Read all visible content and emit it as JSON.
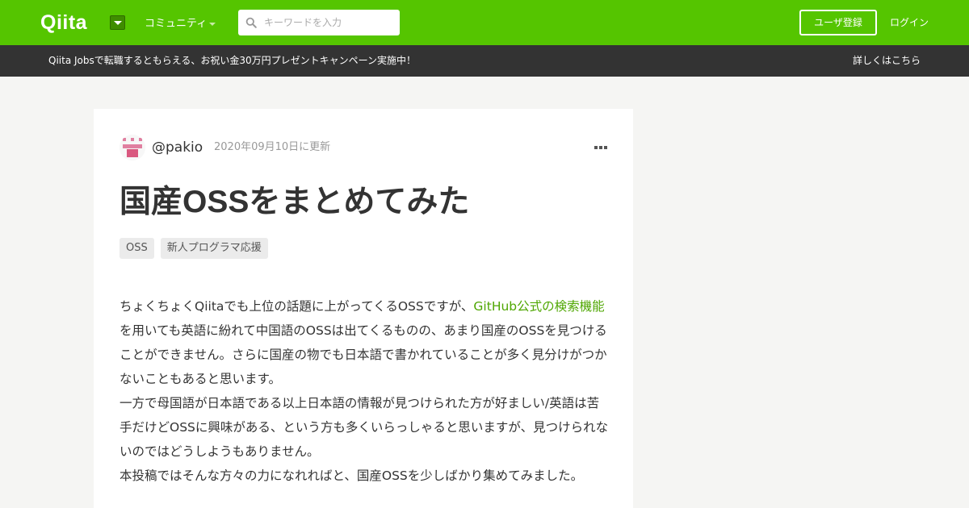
{
  "header": {
    "logo": "Qiita",
    "community_label": "コミュニティ",
    "search_placeholder": "キーワードを入力",
    "signup_label": "ユーザ登録",
    "login_label": "ログイン",
    "brand_color": "#55c500"
  },
  "banner": {
    "text": "Qiita Jobsで転職するともらえる、お祝い金30万円プレゼントキャンペーン実施中！",
    "link": "詳しくはこちら"
  },
  "article": {
    "author": "@pakio",
    "updated": "2020年09月10日に更新",
    "title": "国産OSSをまとめてみた",
    "tags": [
      "OSS",
      "新人プログラマ応援"
    ],
    "para1_before": "ちょくちょくQiitaでも上位の話題に上がってくるOSSですが、",
    "para1_link": "GitHub公式の検索機能",
    "para1_after": "を用いても英語に紛れて中国語のOSSは出てくるものの、あまり国産のOSSを見つけることができません。さらに国産の物でも日本語で書かれていることが多く見分けがつかないこともあると思います。",
    "para2": "一方で母国語が日本語である以上日本語の情報が見つけられた方が好ましい/英語は苦手だけどOSSに興味がある、という方も多くいらっしゃると思いますが、見つけられないのではどうしようもありません。",
    "para3": "本投稿ではそんな方々の力になれればと、国産OSSを少しばかり集めてみました。",
    "link_color": "#4ea600"
  }
}
